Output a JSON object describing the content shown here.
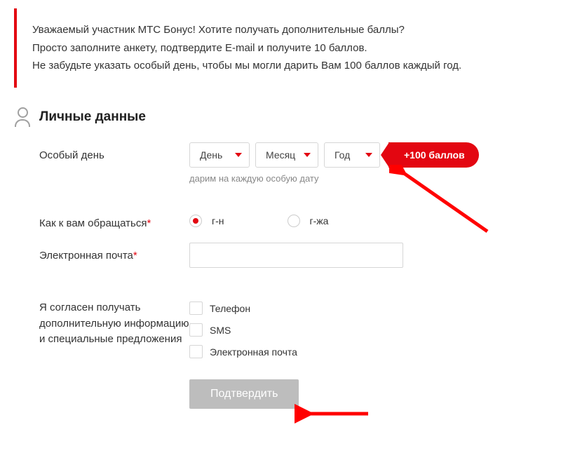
{
  "info": {
    "line1": "Уважаемый участник МТС Бонус! Хотите получать дополнительные баллы?",
    "line2": "Просто заполните анкету, подтвердите E-mail и получите 10 баллов.",
    "line3": "Не забудьте указать особый день, чтобы мы могли дарить Вам 100 баллов каждый год."
  },
  "section_title": "Личные данные",
  "special_day": {
    "label": "Особый день",
    "day": "День",
    "month": "Месяц",
    "year": "Год",
    "badge": "+100 баллов",
    "hint": "дарим на каждую особую дату"
  },
  "salutation": {
    "label": "Как к вам обращаться",
    "option_mr": "г-н",
    "option_mrs": "г-жа",
    "selected": "mr"
  },
  "email": {
    "label": "Электронная почта",
    "value": ""
  },
  "consent": {
    "label": "Я согласен получать дополнительную информацию и специальные предложения",
    "phone": "Телефон",
    "sms": "SMS",
    "email_opt": "Электронная почта"
  },
  "submit_label": "Подтвердить",
  "asterisk": "*",
  "colors": {
    "accent": "#e30611",
    "muted": "#bdbdbd"
  }
}
